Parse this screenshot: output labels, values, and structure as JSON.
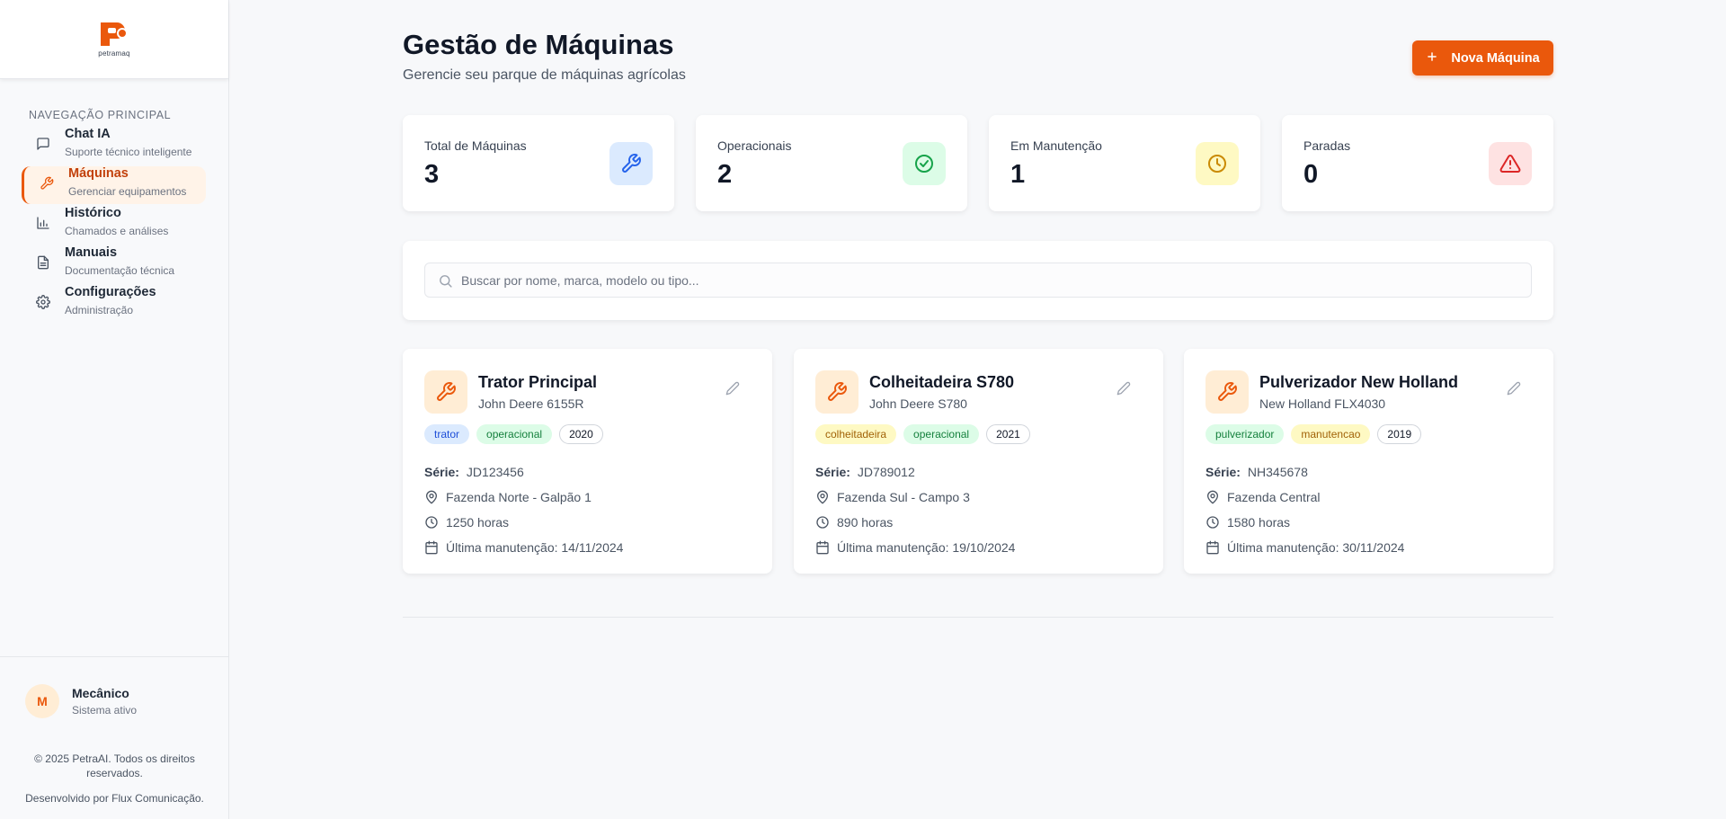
{
  "brand": {
    "logo_text": "petramaq",
    "accent": "#ea580c"
  },
  "sidebar": {
    "section_title": "NAVEGAÇÃO PRINCIPAL",
    "items": [
      {
        "label": "Chat IA",
        "sub": "Suporte técnico inteligente",
        "icon": "chat-icon",
        "active": false
      },
      {
        "label": "Máquinas",
        "sub": "Gerenciar equipamentos",
        "icon": "wrench-icon",
        "active": true
      },
      {
        "label": "Histórico",
        "sub": "Chamados e análises",
        "icon": "bar-chart-icon",
        "active": false
      },
      {
        "label": "Manuais",
        "sub": "Documentação técnica",
        "icon": "document-icon",
        "active": false
      },
      {
        "label": "Configurações",
        "sub": "Administração",
        "icon": "gear-icon",
        "active": false
      }
    ],
    "user": {
      "initial": "M",
      "name": "Mecânico",
      "status": "Sistema ativo"
    },
    "footer": {
      "copyright": "© 2025 PetraAI. Todos os direitos reservados.",
      "developer": "Desenvolvido por Flux Comunicação."
    }
  },
  "header": {
    "title": "Gestão de Máquinas",
    "subtitle": "Gerencie seu parque de máquinas agrícolas",
    "new_button": {
      "icon": "plus-icon",
      "label": "Nova Máquina"
    }
  },
  "stats": [
    {
      "label": "Total de Máquinas",
      "value": "3",
      "icon": "wrench-icon",
      "bg": "#dbeafe",
      "color": "#2563eb"
    },
    {
      "label": "Operacionais",
      "value": "2",
      "icon": "check-circle-icon",
      "bg": "#dcfce7",
      "color": "#16a34a"
    },
    {
      "label": "Em Manutenção",
      "value": "1",
      "icon": "clock-icon",
      "bg": "#fef9c3",
      "color": "#ca8a04"
    },
    {
      "label": "Paradas",
      "value": "0",
      "icon": "alert-triangle-icon",
      "bg": "#fee2e2",
      "color": "#dc2626"
    }
  ],
  "search": {
    "placeholder": "Buscar por nome, marca, modelo ou tipo..."
  },
  "machines": [
    {
      "name": "Trator Principal",
      "model": "John Deere 6155R",
      "tags": [
        {
          "text": "trator",
          "bg": "#dbeafe",
          "color": "#1d4ed8"
        },
        {
          "text": "operacional",
          "bg": "#dcfce7",
          "color": "#15803d"
        },
        {
          "text": "2020",
          "year": true
        }
      ],
      "serie_label": "Série:",
      "serie": "JD123456",
      "location": "Fazenda Norte - Galpão 1",
      "hours": "1250 horas",
      "last_maintenance": "Última manutenção: 14/11/2024"
    },
    {
      "name": "Colheitadeira S780",
      "model": "John Deere S780",
      "tags": [
        {
          "text": "colheitadeira",
          "bg": "#fef9c3",
          "color": "#a16207"
        },
        {
          "text": "operacional",
          "bg": "#dcfce7",
          "color": "#15803d"
        },
        {
          "text": "2021",
          "year": true
        }
      ],
      "serie_label": "Série:",
      "serie": "JD789012",
      "location": "Fazenda Sul - Campo 3",
      "hours": "890 horas",
      "last_maintenance": "Última manutenção: 19/10/2024"
    },
    {
      "name": "Pulverizador New Holland",
      "model": "New Holland FLX4030",
      "tags": [
        {
          "text": "pulverizador",
          "bg": "#dcfce7",
          "color": "#15803d"
        },
        {
          "text": "manutencao",
          "bg": "#fef9c3",
          "color": "#a16207"
        },
        {
          "text": "2019",
          "year": true
        }
      ],
      "serie_label": "Série:",
      "serie": "NH345678",
      "location": "Fazenda Central",
      "hours": "1580 horas",
      "last_maintenance": "Última manutenção: 30/11/2024"
    }
  ]
}
